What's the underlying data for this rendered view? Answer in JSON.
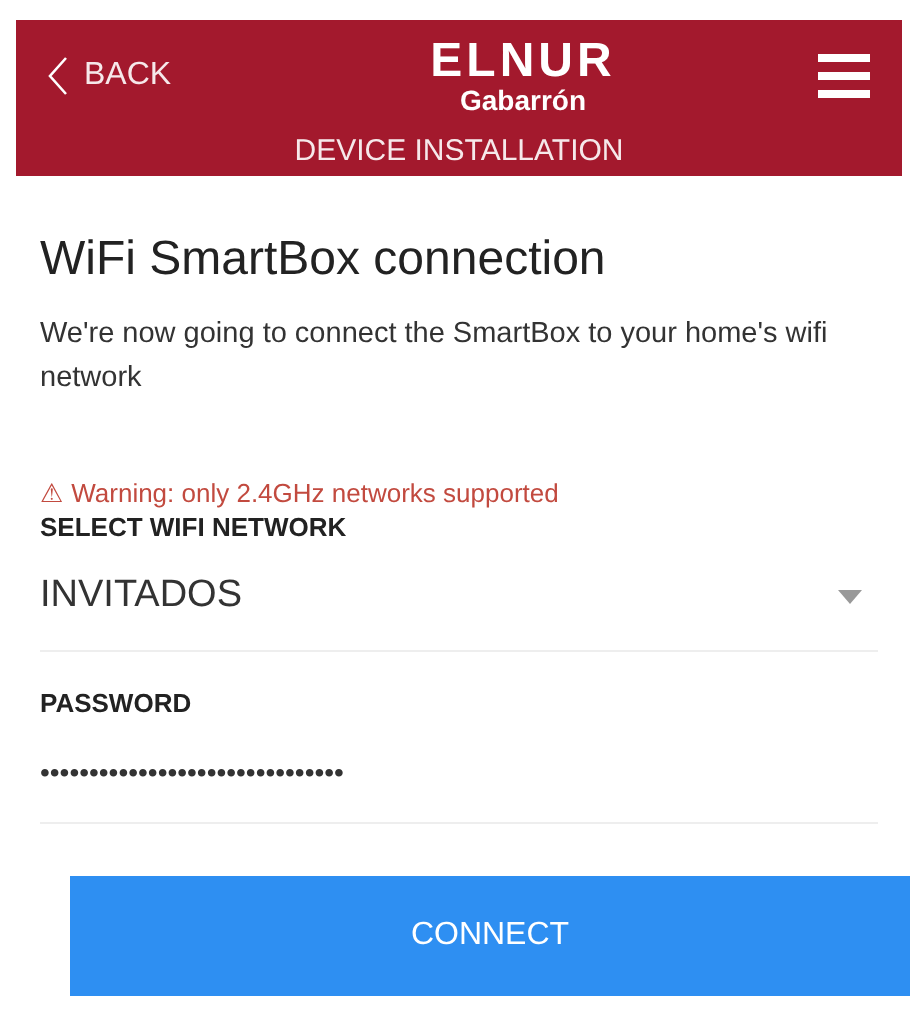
{
  "header": {
    "back": "BACK",
    "logo": {
      "line_1": "ELNUR",
      "line_2": "Gabarrón"
    },
    "subtitle": "DEVICE INSTALLATION"
  },
  "title": "WiFi SmartBox connection",
  "description": "We're now going to connect the SmartBox to your home's wifi network",
  "warning": "⚠ Warning: only 2.4GHz networks supported",
  "network": {
    "label": "SELECT WIFI NETWORK",
    "value": "INVITADOS"
  },
  "password": {
    "label": "PASSWORD",
    "value": "•••••••••••••••••••••••••••••••"
  },
  "button": "CONNECT"
}
